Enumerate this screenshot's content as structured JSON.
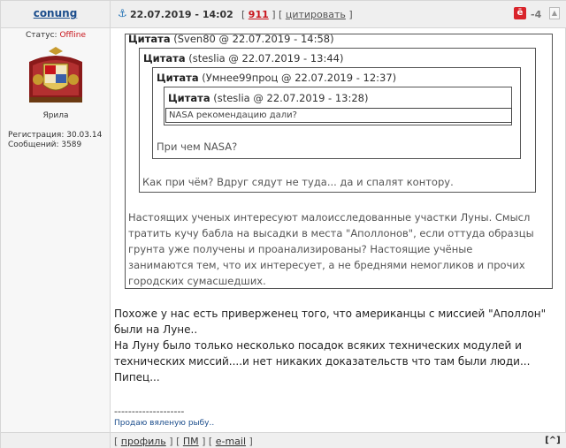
{
  "post": {
    "author": "conung",
    "datetime": "22.07.2019 - 14:02",
    "rep_open": "[",
    "rep_num": "911",
    "rep_mid": "] [",
    "cite_label": "цитировать",
    "rep_close": "]",
    "rating": "-4",
    "rating_icon_glyph": "ē"
  },
  "user": {
    "status_label": "Статус:",
    "status_value": "Offline",
    "rank": "Ярила",
    "reg_line": "Регистрация: 30.03.14",
    "posts_line": "Сообщений: 3589"
  },
  "quotes": {
    "q1": {
      "label": "Цитата",
      "source": "(Sven80 @ 22.07.2019 - 14:58)",
      "text": "Настоящих ученых интересуют малоисследованные участки Луны. Смысл тратить кучу бабла на высадки в места \"Аполлонов\", если оттуда образцы грунта уже получены и проанализированы? Настоящие учёные занимаются тем, что их интересует, а не бреднями немогликов и прочих городских сумасшедших."
    },
    "q2": {
      "label": "Цитата",
      "source": "(steslia @ 22.07.2019 - 13:44)",
      "text": "Как при чём? Вдруг сядут не туда... да и спалят контору."
    },
    "q3": {
      "label": "Цитата",
      "source": "(Умнее99проц @ 22.07.2019 - 12:37)",
      "text": "При чем NASA?"
    },
    "q4": {
      "label": "Цитата",
      "source": "(steslia @ 22.07.2019 - 13:28)",
      "text": "NASA рекомендацию дали?"
    }
  },
  "message": {
    "line1": "Похоже у нас есть приверженец того, что американцы с миссией \"Аполлон\" были на Луне..",
    "line2": "На Луну было только несколько посадок всяких технических модулей и технических миссий....и нет никаких доказательств что там были люди...",
    "line3": "Пипец..."
  },
  "signature": {
    "divider": "--------------------",
    "text": "Продаю вяленую рыбу.."
  },
  "footer": {
    "b1": "[",
    "profile": "профиль",
    "b2": "] [",
    "pm": "ПМ",
    "b3": "] [",
    "email": "e-mail",
    "b4": "]",
    "up": "[^]"
  },
  "icons": {
    "anchor": "⚓"
  },
  "colors": {
    "link": "#1b4d8c",
    "rep": "#c8141b",
    "offline": "#c8141b",
    "header_bg": "#efefef"
  }
}
